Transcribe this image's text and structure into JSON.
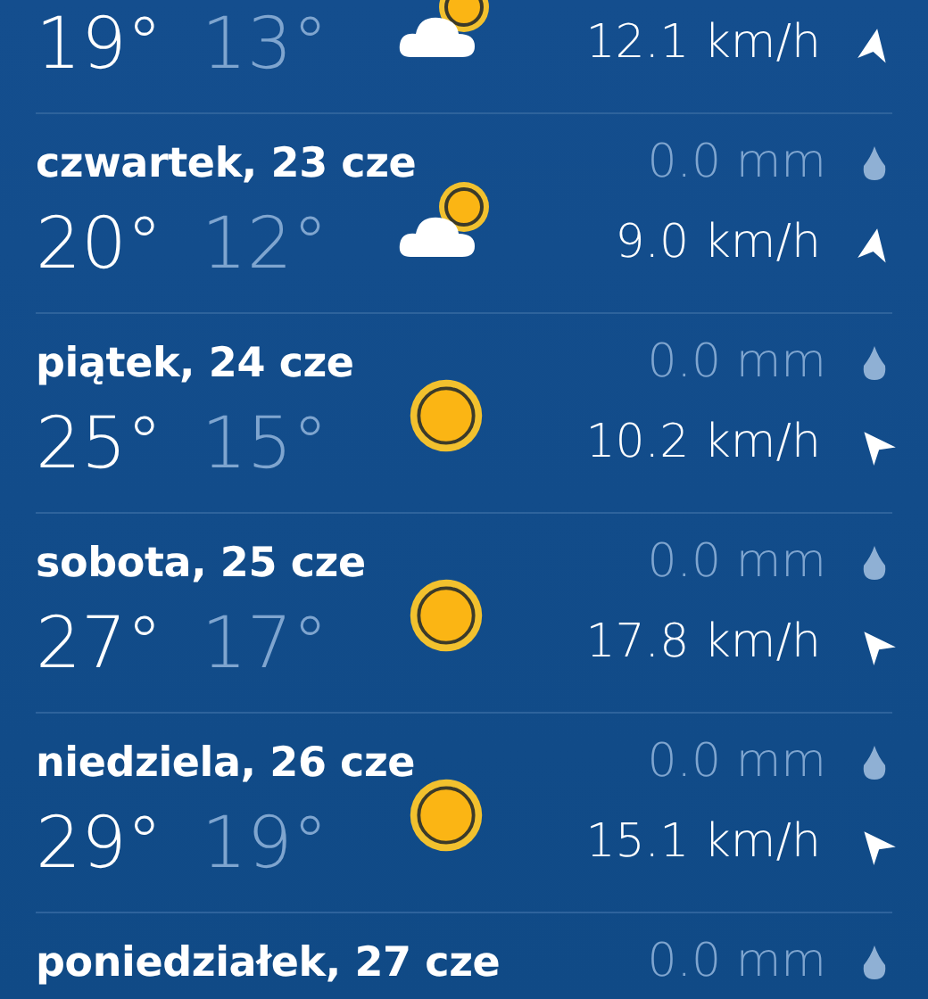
{
  "days": [
    {
      "high": "19°",
      "low": "13°",
      "wind": "12.1 km/h",
      "arrow": {
        "kind": "up"
      },
      "kind": "cloudy"
    },
    {
      "date": "czwartek, 23 cze",
      "high": "20°",
      "low": "12°",
      "rain": "0.0 mm",
      "wind": "9.0 km/h",
      "arrow": {
        "kind": "up"
      },
      "kind": "cloudy"
    },
    {
      "date": "piątek, 24 cze",
      "high": "25°",
      "low": "15°",
      "rain": "0.0 mm",
      "wind": "10.2 km/h",
      "arrow": {
        "kind": "upleft"
      },
      "kind": "sunny"
    },
    {
      "date": "sobota, 25 cze",
      "high": "27°",
      "low": "17°",
      "rain": "0.0 mm",
      "wind": "17.8 km/h",
      "arrow": {
        "kind": "upleft"
      },
      "kind": "sunny"
    },
    {
      "date": "niedziela, 26 cze",
      "high": "29°",
      "low": "19°",
      "rain": "0.0 mm",
      "wind": "15.1 km/h",
      "arrow": {
        "kind": "upleft"
      },
      "kind": "sunny"
    },
    {
      "date": "poniedziałek, 27 cze",
      "rain": "0.0 mm"
    }
  ]
}
